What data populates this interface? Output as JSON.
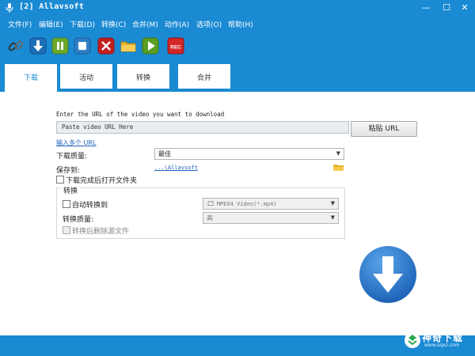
{
  "window": {
    "title": "[2] Allavsoft",
    "minimize": "—",
    "maximize": "☐",
    "close": "✕"
  },
  "menu": {
    "items": [
      "文件(F)",
      "编辑(E)",
      "下载(D)",
      "转换(C)",
      "合并(M)",
      "动作(A)",
      "选项(O)",
      "帮助(H)"
    ]
  },
  "toolbar": {
    "buttons": [
      "link-icon",
      "download-icon",
      "pause-icon",
      "stop-icon",
      "delete-icon",
      "folder-icon",
      "play-icon",
      "record-icon"
    ],
    "rec_label": "REC"
  },
  "tabs": [
    "下载",
    "活动",
    "转换",
    "合并"
  ],
  "download": {
    "prompt": "Enter the URL of the video you want to download",
    "url_value": "Paste video URL Here",
    "paste_button": "粘贴 URL",
    "multi_url_link": "输入多个 URL",
    "quality_label": "下载质量:",
    "quality_value": "最佳",
    "save_to_label": "保存到:",
    "save_path": "...\\Allavsoft",
    "open_folder_label": "下载完成后打开文件夹"
  },
  "convert_group": {
    "title": "转换",
    "auto_convert_label": "自动转换到",
    "format_value": "MPEG4 Video(*.mp4)",
    "quality_label": "转换质量:",
    "quality_value": "高",
    "delete_source_label": "转换后删除源文件"
  },
  "watermark": {
    "text": "神奇下载",
    "sub": "www.sqxz.com"
  },
  "colors": {
    "brand_blue": "#1a8ad3",
    "link_blue": "#1f5fbf"
  }
}
